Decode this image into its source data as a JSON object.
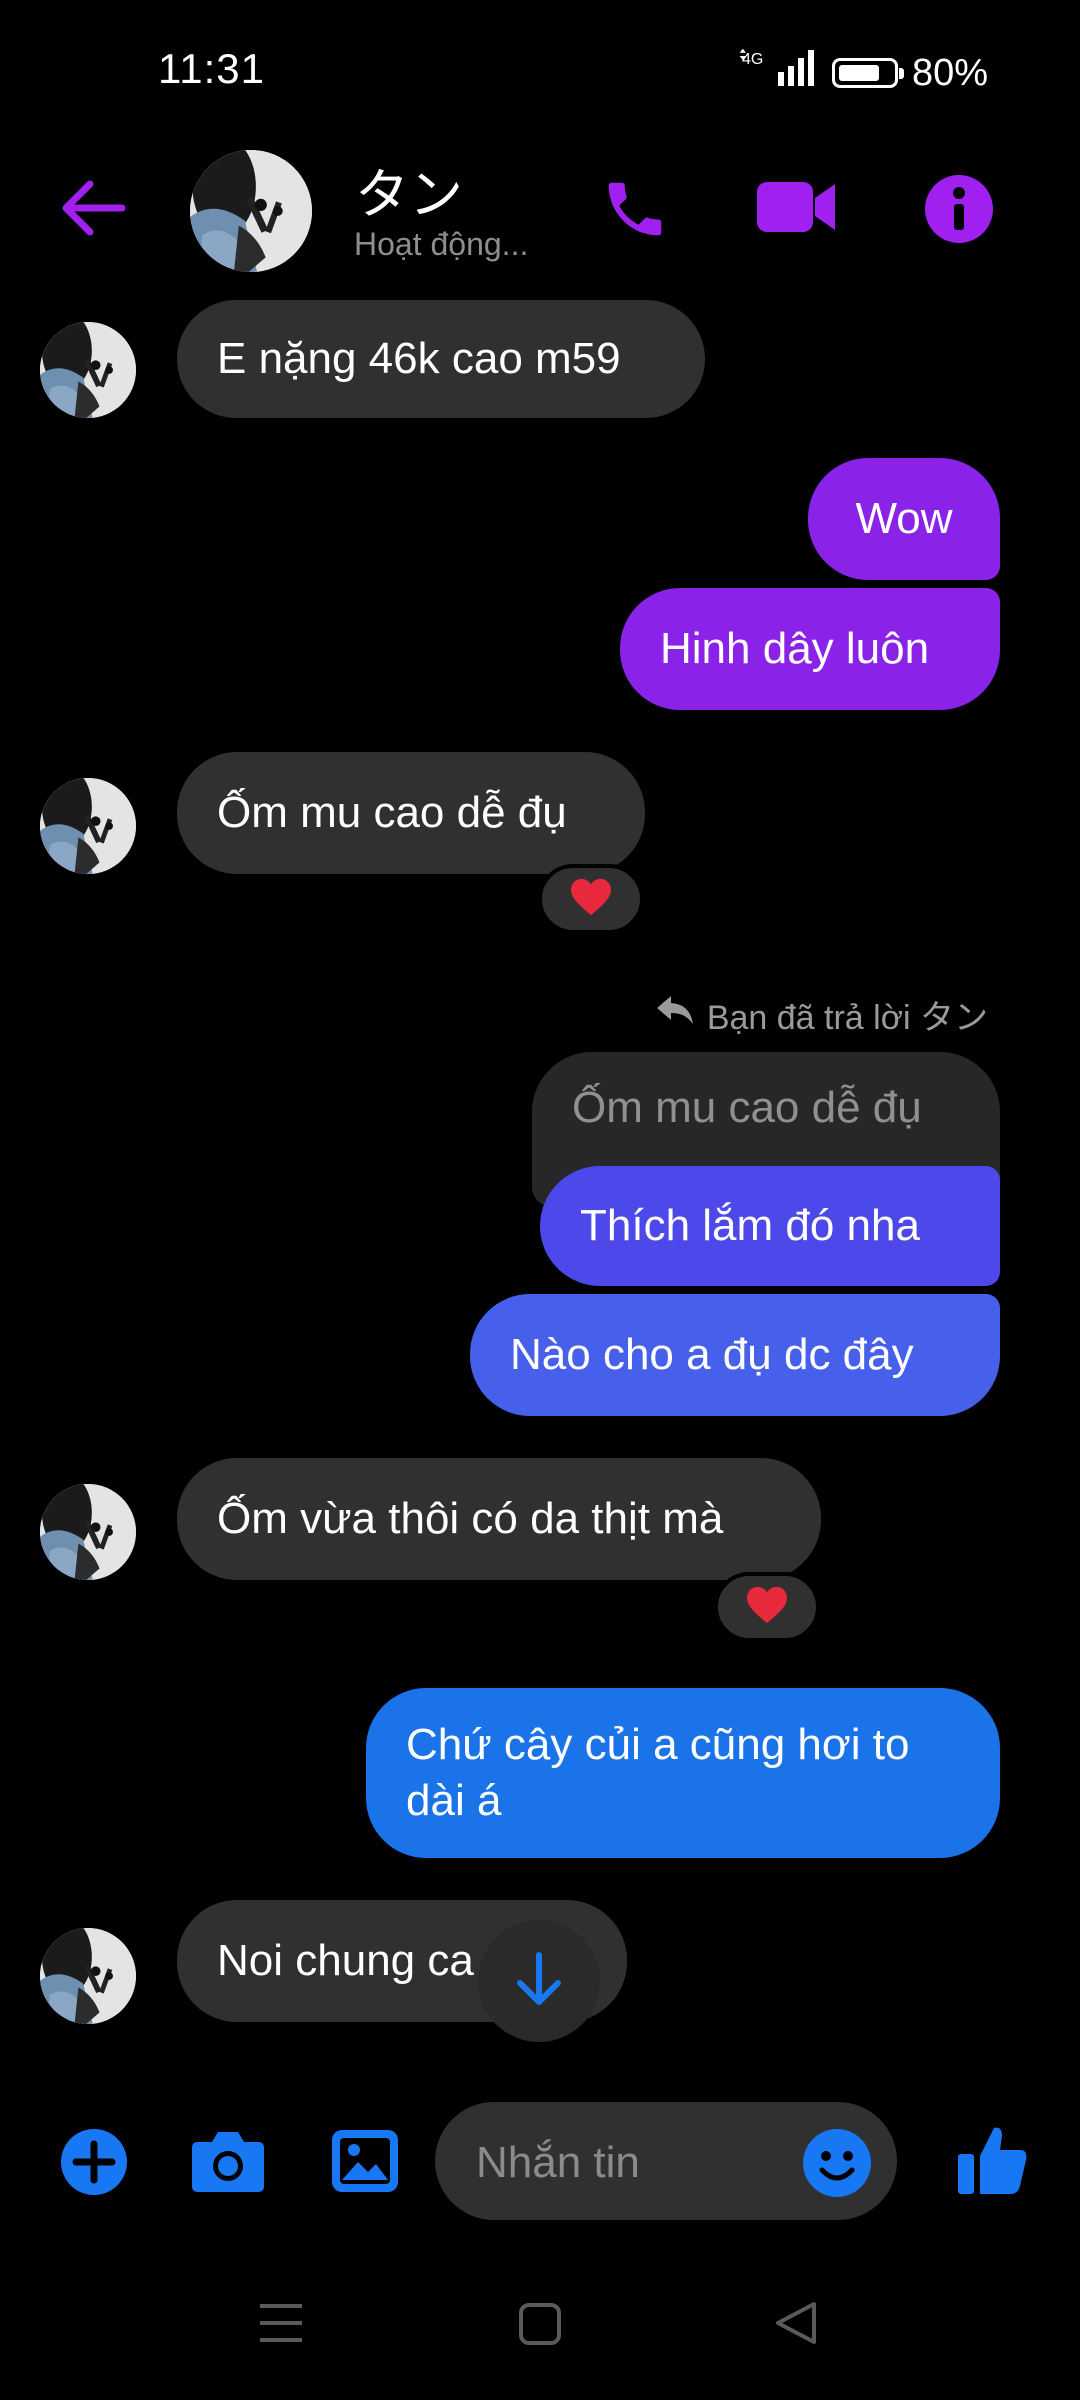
{
  "status_bar": {
    "time": "11:31",
    "network": "4G",
    "battery": "80%",
    "battery_level": 0.8
  },
  "header": {
    "name": "タン",
    "status": "Hoạt động..."
  },
  "messages": [
    {
      "side": "in",
      "text": "E nặng 46k cao m59"
    },
    {
      "side": "out",
      "text": "Wow"
    },
    {
      "side": "out",
      "text": "Hinh dây luôn"
    },
    {
      "side": "in",
      "text": "Ốm mu cao dễ đụ",
      "reaction": "heart"
    },
    {
      "reply_label": "Bạn đã trả lời タン",
      "quoted": "Ốm mu cao dễ đụ"
    },
    {
      "side": "out",
      "text": "Thích lắm đó nha"
    },
    {
      "side": "out",
      "text": "Nào cho a đụ dc đây"
    },
    {
      "side": "in",
      "text": "Ốm vừa thôi có da thịt mà",
      "reaction": "heart"
    },
    {
      "side": "out",
      "text_line1": "Chứ cây củi a cũng hơi to",
      "text_line2": "dài á"
    },
    {
      "side": "in",
      "text": "Noi chung ca"
    }
  ],
  "composer": {
    "placeholder": "Nhắn tin"
  },
  "colors": {
    "accent": "#a020f0",
    "bubble_in": "#303030",
    "send_blue": "#1877f2"
  },
  "icons": [
    "back-arrow-icon",
    "phone-icon",
    "video-camera-icon",
    "info-icon",
    "reply-arrow-icon",
    "heart-icon",
    "scroll-down-arrow-icon",
    "plus-icon",
    "camera-icon",
    "gallery-icon",
    "emoji-icon",
    "thumbs-up-icon",
    "menu-nav-icon",
    "home-nav-icon",
    "back-nav-icon"
  ]
}
